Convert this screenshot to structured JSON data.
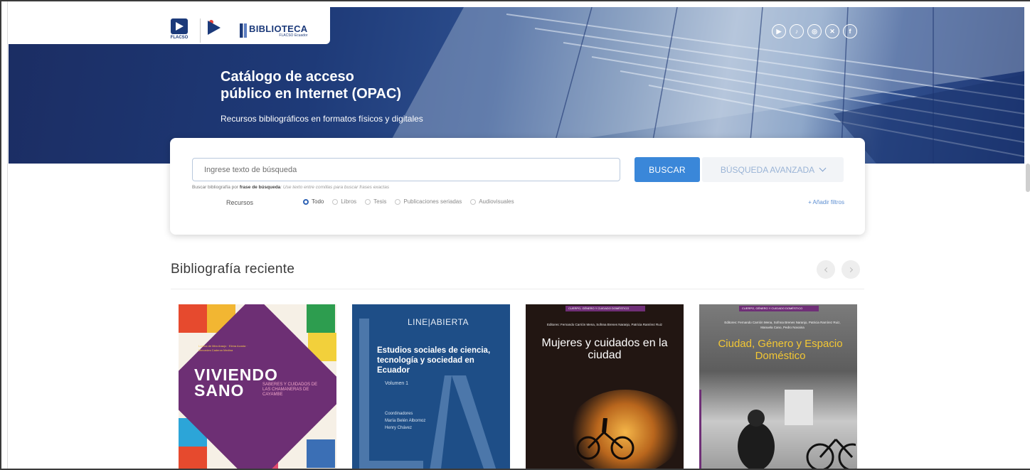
{
  "header": {
    "logos": {
      "flacso": "FLACSO",
      "biblioteca": "BIBLIOTECA",
      "biblioteca_sub": "FLACSO Ecuador"
    },
    "socials": [
      {
        "icon": "youtube-icon",
        "glyph": "▶"
      },
      {
        "icon": "tiktok-icon",
        "glyph": "♪"
      },
      {
        "icon": "instagram-icon",
        "glyph": "◎"
      },
      {
        "icon": "x-icon",
        "glyph": "✕"
      },
      {
        "icon": "facebook-icon",
        "glyph": "f"
      }
    ]
  },
  "hero": {
    "title_line1": "Catálogo de acceso",
    "title_line2": "público en Internet (OPAC)",
    "subtitle": "Recursos bibliográficos en formatos físicos y digitales"
  },
  "search": {
    "placeholder": "Ingrese texto de búsqueda",
    "buscar_label": "BUSCAR",
    "advanced_label": "BÚSQUEDA AVANZADA",
    "hint_prefix": "Buscar bibliografía por ",
    "hint_bold": "frase de búsqueda",
    "hint_italic": ": Use texto entre comillas para buscar frases exactas",
    "resources_label": "Recursos",
    "resource_options": [
      {
        "label": "Todo",
        "selected": true
      },
      {
        "label": "Libros",
        "selected": false
      },
      {
        "label": "Tesis",
        "selected": false
      },
      {
        "label": "Publicaciones seriadas",
        "selected": false
      },
      {
        "label": "Audiovisuales",
        "selected": false
      }
    ],
    "add_filters": "+ Añadir filtros"
  },
  "recent": {
    "title": "Bibliografía reciente",
    "books": [
      {
        "pre": "Lorena de Mira Araujo · Elena Acosta · Mercedes Caderon Medina",
        "title_line1": "VIVIENDO",
        "title_line2": "SANO",
        "subtitle": "SABERES Y CUIDADOS DE LAS CHAMANERAS DE CAYAMBE"
      },
      {
        "brand": "LINE|ABIERTA",
        "title": "Estudios sociales de ciencia, tecnología y sociedad en Ecuador",
        "volume": "Volumen 1",
        "coord": "Coordinadores\nMaría Belén Albornoz\nHenry Chávez"
      },
      {
        "band": "CUERPO, GÉNERO Y CUIDADO DOMÉSTICO",
        "editors": "Editores: Fernando Carrión Mena, Sofnna Brenes Naranjo, Patricia Ramírez Ruiz",
        "title": "Mujeres y cuidados en la ciudad"
      },
      {
        "band": "CUERPO, GÉNERO Y CUIDADO DOMÉSTICO",
        "editors": "Editores: Fernando Carrión Mena, Sofnna Brenes Naranjo, Patricia Ramírez Ruiz, Manuela Cano, Pedro Novaina",
        "title": "Ciudad, Género y Espacio Doméstico"
      }
    ]
  },
  "colors": {
    "accent": "#3a87d9",
    "brand_navy": "#1c3a7a",
    "purple": "#6f2f77"
  }
}
